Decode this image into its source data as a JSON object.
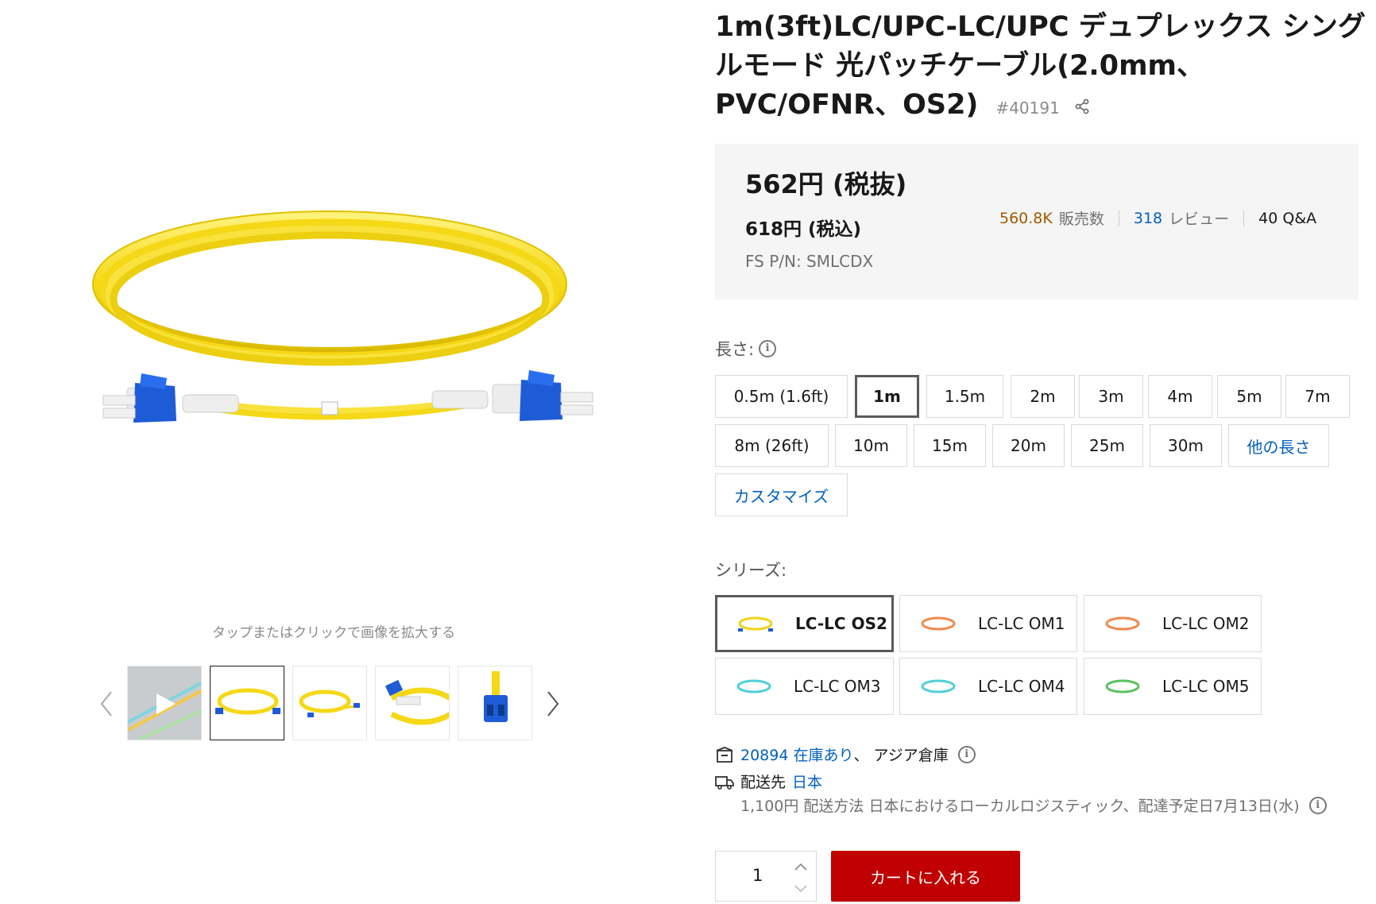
{
  "product": {
    "title": "1m(3ft)LC/UPC-LC/UPC デュプレックス シングルモード 光パッチケーブル(2.0mm、PVC/OFNR、OS2)",
    "sku": "#40191"
  },
  "gallery": {
    "zoom_hint": "タップまたはクリックで画像を拡大する",
    "thumbnails": [
      "video-thumbnail",
      "yellow-coil",
      "yellow-coil-side",
      "connector-closeup",
      "lc-connector-front"
    ],
    "active_index": 1
  },
  "price": {
    "excl_tax": "562円 (税抜)",
    "incl_tax": "618円 (税込)",
    "part_number": "FS P/N: SMLCDX",
    "sold_count": "560.8K",
    "sold_label": "販売数",
    "review_count": "318",
    "review_label": "レビュー",
    "qa": "40 Q&A"
  },
  "length": {
    "label": "長さ:",
    "options": [
      "0.5m (1.6ft)",
      "1m",
      "1.5m",
      "2m",
      "3m",
      "4m",
      "5m",
      "7m",
      "8m (26ft)",
      "10m",
      "15m",
      "20m",
      "25m",
      "30m",
      "他の長さ",
      "カスタマイズ"
    ],
    "selected": "1m"
  },
  "series": {
    "label": "シリーズ:",
    "options": [
      {
        "label": "LC-LC OS2",
        "color": "#f2d21a"
      },
      {
        "label": "LC-LC OM1",
        "color": "#f08a4b"
      },
      {
        "label": "LC-LC OM2",
        "color": "#f08a4b"
      },
      {
        "label": "LC-LC OM3",
        "color": "#4fd0d6"
      },
      {
        "label": "LC-LC OM4",
        "color": "#4fd0d6"
      },
      {
        "label": "LC-LC OM5",
        "color": "#5cc160"
      }
    ],
    "selected": "LC-LC OS2"
  },
  "stock": {
    "count_text": "20894 在庫あり",
    "warehouse": "、 アジア倉庫"
  },
  "shipping": {
    "to_label": "配送先",
    "country": "日本",
    "detail": "1,100円 配送方法 日本におけるローカルロジスティック、配達予定日7月13日(水)"
  },
  "cart": {
    "quantity": "1",
    "add_label": "カートに入れる"
  },
  "colors": {
    "accent_red": "#c00000",
    "link_blue": "#0060bf",
    "cable_yellow": "#f7dc2a",
    "connector_blue": "#1e5bd6"
  }
}
